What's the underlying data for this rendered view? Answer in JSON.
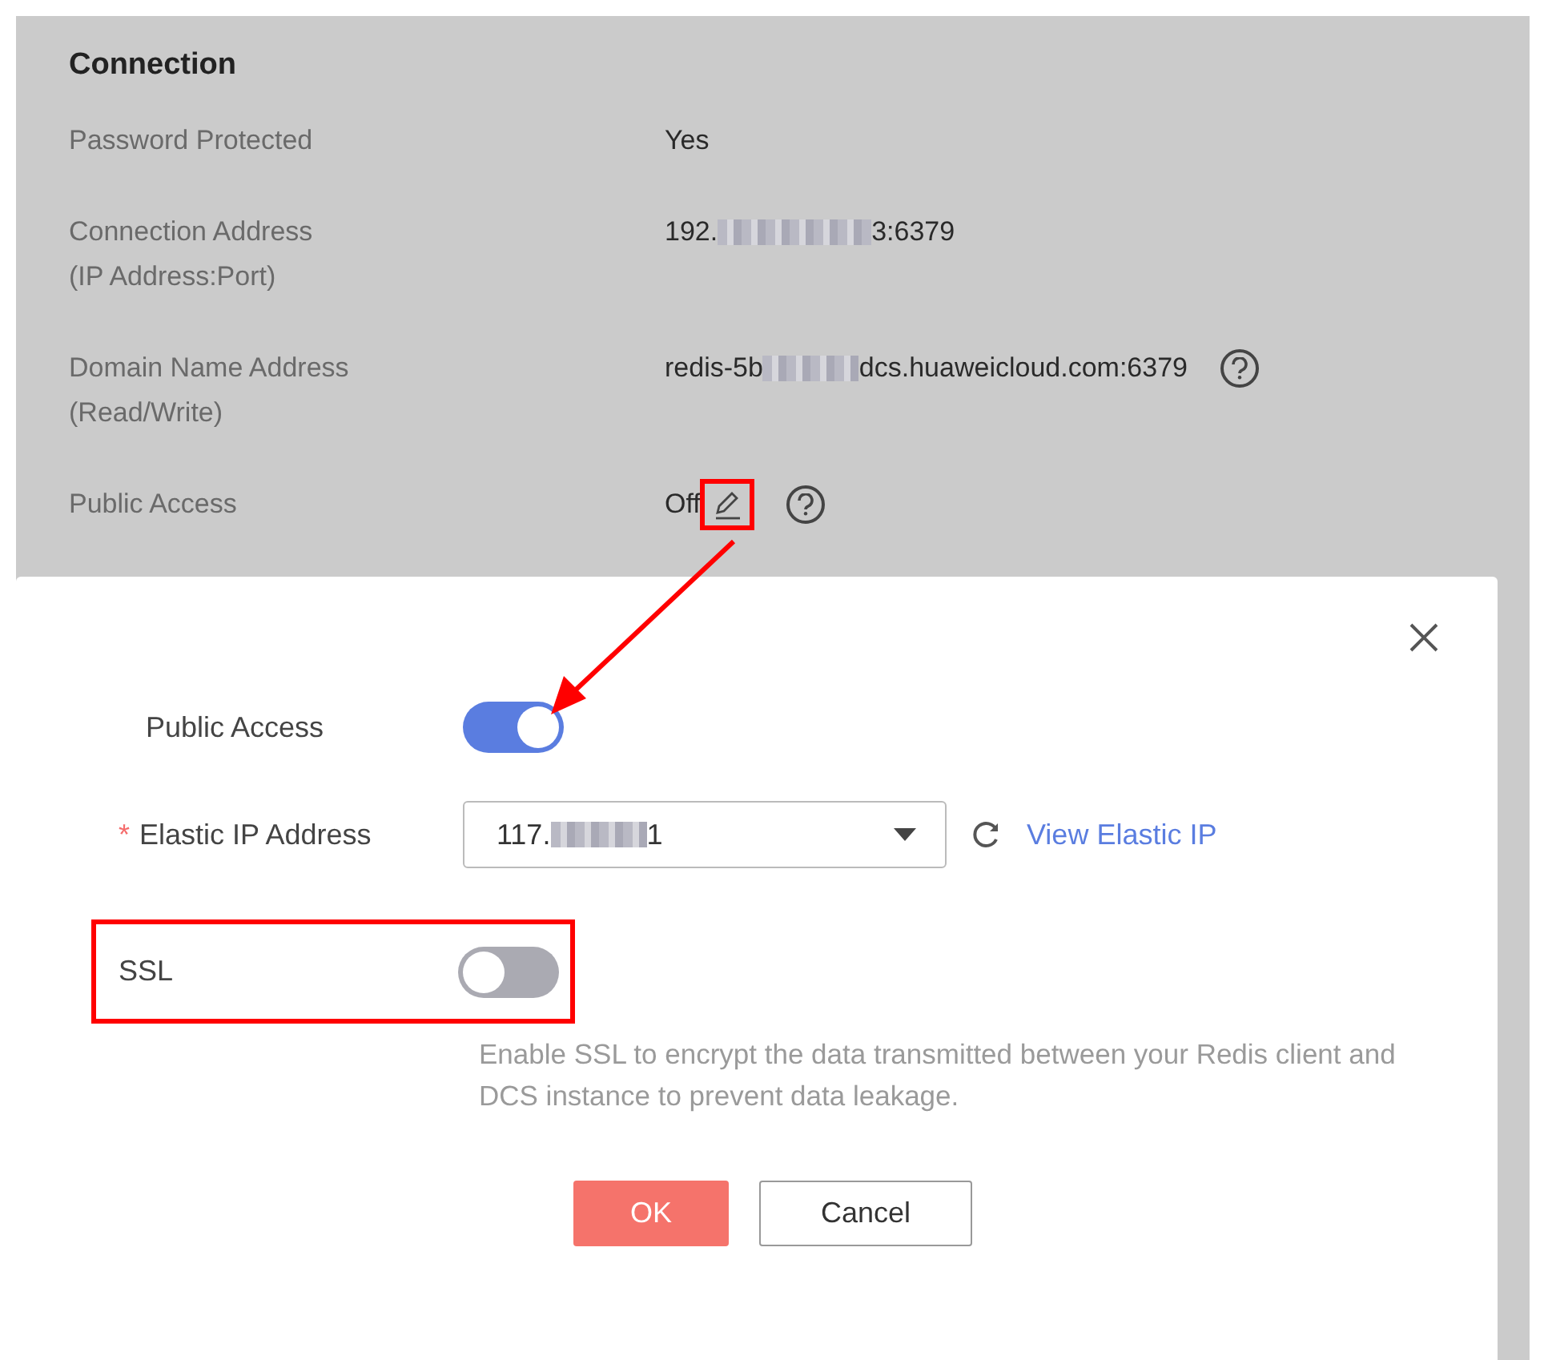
{
  "connection": {
    "title": "Connection",
    "fields": [
      {
        "label_lines": [
          "Password Protected"
        ],
        "value_parts": [
          "Yes"
        ],
        "editable": false,
        "help": false
      },
      {
        "label_lines": [
          "Connection Address",
          "(IP Address:Port)"
        ],
        "value_parts": [
          "192.",
          "3:6379"
        ],
        "editable": false,
        "help": false
      },
      {
        "label_lines": [
          "Domain Name Address",
          "(Read/Write)"
        ],
        "value_parts": [
          "redis-5b",
          "dcs.huaweicloud.com:6379"
        ],
        "editable": false,
        "help": true
      },
      {
        "label_lines": [
          "Public Access"
        ],
        "value_parts": [
          "Off"
        ],
        "editable": true,
        "help": true
      }
    ]
  },
  "dialog": {
    "public_access": {
      "label": "Public Access",
      "on": true
    },
    "elastic_ip": {
      "label": "Elastic IP Address",
      "required": true,
      "required_mark": "*",
      "value_parts": [
        "117.",
        "1"
      ],
      "link": "View Elastic IP"
    },
    "ssl": {
      "label": "SSL",
      "on": false,
      "description": "Enable SSL to encrypt the data transmitted between your Redis client and DCS instance to prevent data leakage."
    },
    "buttons": {
      "ok": "OK",
      "cancel": "Cancel"
    }
  }
}
